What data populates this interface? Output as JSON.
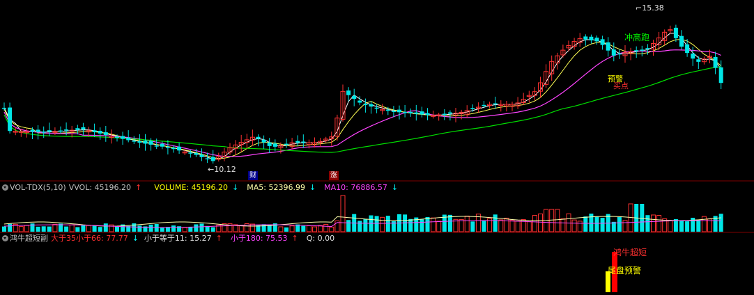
{
  "colors": {
    "up": "#ff3232",
    "down": "#00e6e6",
    "ma_white": "#ffffff",
    "ma_yellow": "#ffff55",
    "ma_magenta": "#ff44ff",
    "ma_green": "#00dd00",
    "grid": "#800000",
    "vol_ma5": "#ffffaa",
    "vol_ma10": "#ff44ff",
    "bull_red": "#ff0000",
    "bull_yellow": "#ffff00"
  },
  "price_panel": {
    "high_label": "15.38",
    "low_label": "10.12",
    "signal_chonggaopao": "冲高跑",
    "signal_yujing": "预警",
    "signal_maidian": "买点",
    "marker_cai": "财",
    "marker_zhang": "涨"
  },
  "volume_panel": {
    "name": "VOL-TDX(5,10)",
    "vvol": "VVOL: 45196.20",
    "vvol_arrow": "↑",
    "volume": "VOLUME: 45196.20",
    "volume_arrow": "↓",
    "ma5": "MA5: 52396.99",
    "ma5_arrow": "↓",
    "ma10": "MA10: 76886.57",
    "ma10_arrow": "↓"
  },
  "bull_panel": {
    "name": "鸿牛超短副",
    "v1": "大于35小于66: 77.77",
    "v1_arrow": "↓",
    "v2": "小于等于11: 15.27",
    "v2_arrow": "↑",
    "v3": "小于180: 75.53",
    "v3_arrow": "↑",
    "q": "Q: 0.00",
    "signal_bull": "鸿牛超短",
    "signal_tail": "尾盘预警"
  }
}
